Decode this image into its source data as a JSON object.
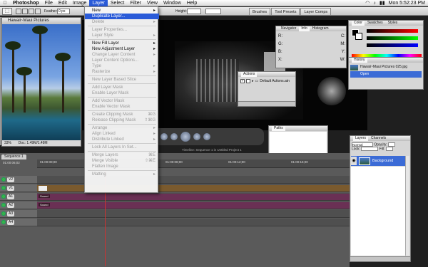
{
  "menubar": {
    "apple": "",
    "items": [
      "Photoshop",
      "File",
      "Edit",
      "Image",
      "Layer",
      "Select",
      "Filter",
      "View",
      "Window",
      "Help"
    ],
    "clock": "Mon 5:52:23 PM",
    "battery": "▮▮",
    "wifi": "◠",
    "volume": "♪"
  },
  "options": {
    "feather_label": "Feather:",
    "feather_value": "0 px",
    "height_label": "Height:"
  },
  "wells": [
    "Brushes",
    "Tool Presets",
    "Layer Comps"
  ],
  "image_window": {
    "title": "Hawaii~Maui Pictures",
    "zoom": "33%",
    "doc": "Doc: 1.49M/1.49M"
  },
  "layer_menu": [
    {
      "label": "New",
      "enabled": true,
      "arrow": true
    },
    {
      "label": "Duplicate Layer...",
      "enabled": true,
      "highlighted": true
    },
    {
      "label": "Delete",
      "enabled": false,
      "arrow": true
    },
    {
      "sep": true
    },
    {
      "label": "Layer Properties...",
      "enabled": false
    },
    {
      "label": "Layer Style",
      "enabled": false,
      "arrow": true
    },
    {
      "sep": true
    },
    {
      "label": "New Fill Layer",
      "enabled": true,
      "arrow": true
    },
    {
      "label": "New Adjustment Layer",
      "enabled": true,
      "arrow": true
    },
    {
      "label": "Change Layer Content",
      "enabled": false,
      "arrow": true
    },
    {
      "label": "Layer Content Options...",
      "enabled": false
    },
    {
      "label": "Type",
      "enabled": false,
      "arrow": true
    },
    {
      "label": "Rasterize",
      "enabled": false,
      "arrow": true
    },
    {
      "sep": true
    },
    {
      "label": "New Layer Based Slice",
      "enabled": false
    },
    {
      "sep": true
    },
    {
      "label": "Add Layer Mask",
      "enabled": false
    },
    {
      "label": "Enable Layer Mask",
      "enabled": false
    },
    {
      "sep": true
    },
    {
      "label": "Add Vector Mask",
      "enabled": false
    },
    {
      "label": "Enable Vector Mask",
      "enabled": false
    },
    {
      "sep": true
    },
    {
      "label": "Create Clipping Mask",
      "enabled": false,
      "shortcut": "⌘G"
    },
    {
      "label": "Release Clipping Mask",
      "enabled": false,
      "shortcut": "⇧⌘G"
    },
    {
      "sep": true
    },
    {
      "label": "Arrange",
      "enabled": false,
      "arrow": true
    },
    {
      "label": "Align Linked",
      "enabled": false,
      "arrow": true
    },
    {
      "label": "Distribute Linked",
      "enabled": false,
      "arrow": true
    },
    {
      "sep": true
    },
    {
      "label": "Lock All Layers In Set...",
      "enabled": false
    },
    {
      "sep": true
    },
    {
      "label": "Merge Layers",
      "enabled": false,
      "shortcut": "⌘E"
    },
    {
      "label": "Merge Visible",
      "enabled": false,
      "shortcut": "⇧⌘E"
    },
    {
      "label": "Flatten Image",
      "enabled": false
    },
    {
      "sep": true
    },
    {
      "label": "Matting",
      "enabled": false,
      "arrow": true
    }
  ],
  "navigator": {
    "tabs": [
      "Navigator",
      "Info",
      "Histogram"
    ],
    "rows": [
      [
        "R:",
        "C:"
      ],
      [
        "G:",
        "M:"
      ],
      [
        "B:",
        "Y:"
      ],
      [
        "X:",
        "W:"
      ]
    ]
  },
  "color_panel": {
    "tabs": [
      "Color",
      "Swatches",
      "Styles"
    ],
    "channels": [
      "R",
      "G",
      "B"
    ]
  },
  "history": {
    "tabs": [
      "History"
    ],
    "snapshot": "Hawaii~Maui Pictures 025.jpg",
    "state": "Open"
  },
  "actions": {
    "tabs": [
      "Actions"
    ],
    "item": "Default Actions.atn"
  },
  "paths": {
    "tabs": [
      "Paths"
    ]
  },
  "layers_panel": {
    "tabs": [
      "Layers",
      "Channels"
    ],
    "blend": "Normal",
    "opacity_label": "Opacity:",
    "lock_label": "Lock:",
    "fill_label": "Fill:",
    "layer_name": "Background",
    "eye": "◉"
  },
  "timeline": {
    "tab": "Sequence 1",
    "timecode": "01:00:06;02",
    "ruler_marks": [
      "01:00:00;00",
      "01:00:04;00",
      "01:00:08;00",
      "01:00:12;00",
      "01:00:16;00"
    ],
    "tracks": [
      {
        "name": "V2",
        "type": "empty"
      },
      {
        "name": "V1",
        "type": "video",
        "clip": ""
      },
      {
        "name": "A1",
        "type": "audio",
        "clip": "Sound"
      },
      {
        "name": "A2",
        "type": "audio",
        "clip": "Sound"
      },
      {
        "name": "A3",
        "type": "empty"
      },
      {
        "name": "A4",
        "type": "empty"
      }
    ],
    "title_label": "Timeline: Sequence 1 in Untitled Project 1"
  }
}
